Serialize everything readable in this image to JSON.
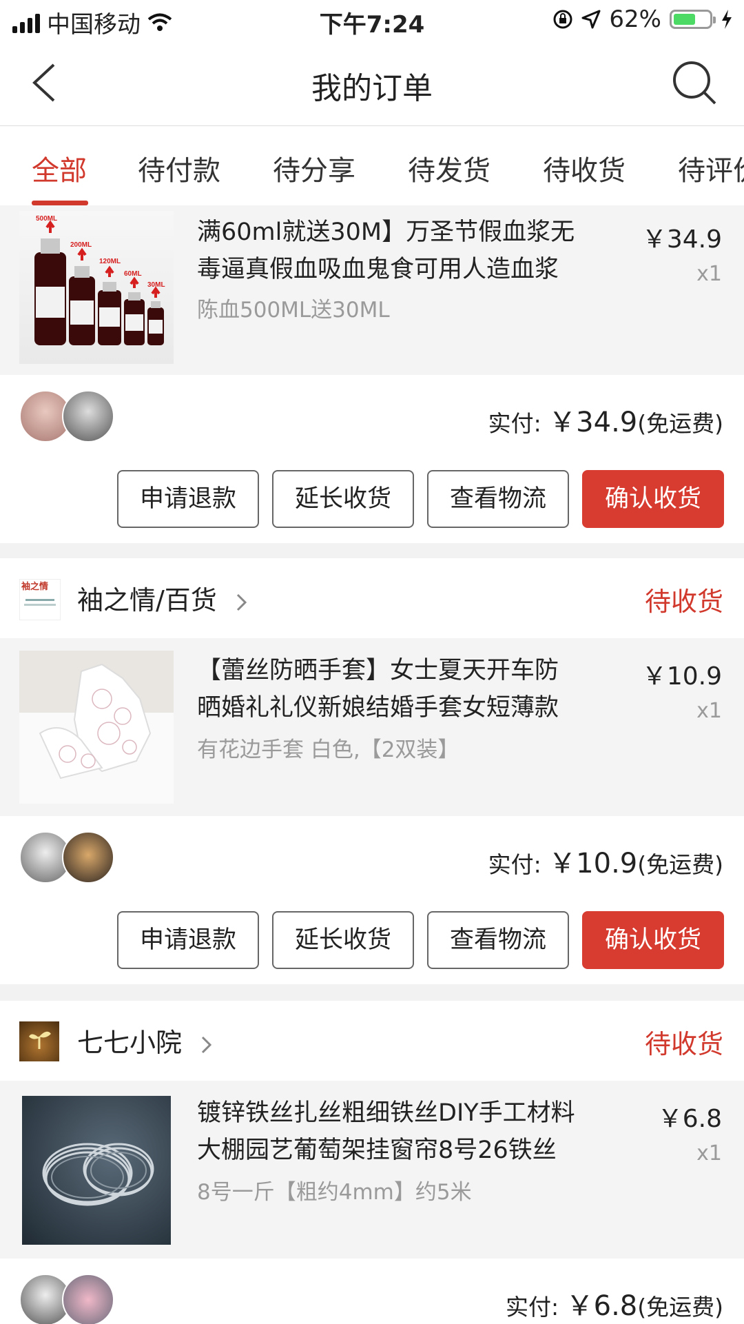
{
  "status_bar": {
    "carrier": "中国移动",
    "time": "下午7:24",
    "battery_text": "62%",
    "battery_level": 0.62
  },
  "nav": {
    "title": "我的订单",
    "back_icon": "chevron-left-icon",
    "search_icon": "search-icon"
  },
  "tabs": [
    "全部",
    "待付款",
    "待分享",
    "待发货",
    "待收货",
    "待评价"
  ],
  "active_tab": 0,
  "colors": {
    "accent": "#d2392d",
    "button_primary": "#d83c31"
  },
  "orders": [
    {
      "item": {
        "title_line1": "满60ml就送30M】万圣节假血浆无",
        "title_line2": "毒逼真假血吸血鬼食可用人造血浆",
        "spec": "陈血500ML送30ML",
        "price": "￥34.9",
        "qty": "x1",
        "image_labels": [
          "500ML",
          "200ML",
          "120ML",
          "60ML",
          "30ML"
        ]
      },
      "summary": {
        "paid_label": "实付: ",
        "paid_amount": "￥34.9",
        "shipping": "(免运费)"
      },
      "actions": [
        "申请退款",
        "延长收货",
        "查看物流",
        "确认收货"
      ]
    },
    {
      "shop": {
        "name": "袖之情/百货",
        "status": "待收货",
        "logo_text": "袖之情"
      },
      "item": {
        "title_line1": "【蕾丝防晒手套】女士夏天开车防",
        "title_line2": "晒婚礼礼仪新娘结婚手套女短薄款",
        "spec": "有花边手套  白色,【2双装】",
        "price": "￥10.9",
        "qty": "x1"
      },
      "summary": {
        "paid_label": "实付: ",
        "paid_amount": "￥10.9",
        "shipping": "(免运费)"
      },
      "actions": [
        "申请退款",
        "延长收货",
        "查看物流",
        "确认收货"
      ]
    },
    {
      "shop": {
        "name": "七七小院",
        "status": "待收货"
      },
      "item": {
        "title_line1": "镀锌铁丝扎丝粗细铁丝DIY手工材料",
        "title_line2": "大棚园艺葡萄架挂窗帘8号26铁丝",
        "spec": "8号一斤【粗约4mm】约5米",
        "price": "￥6.8",
        "qty": "x1"
      },
      "summary": {
        "paid_label": "实付: ",
        "paid_amount": "￥6.8",
        "shipping": "(免运费)"
      }
    }
  ]
}
